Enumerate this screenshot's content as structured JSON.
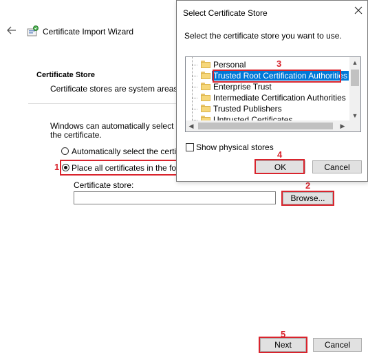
{
  "wizard": {
    "title": "Certificate Import Wizard",
    "section_title": "Certificate Store",
    "section_description": "Certificate stores are system areas wh",
    "intro_line1": "Windows can automatically select a ce",
    "intro_line2": "the certificate.",
    "radio_auto_label": "Automatically select the certifica",
    "radio_place_label": "Place all certificates in the follow",
    "store_field_label": "Certificate store:",
    "store_field_value": "",
    "browse_label": "Browse...",
    "next_label": "Next",
    "cancel_label": "Cancel"
  },
  "dialog": {
    "title": "Select Certificate Store",
    "instruction": "Select the certificate store you want to use.",
    "stores": [
      {
        "label": "Personal",
        "selected": false
      },
      {
        "label": "Trusted Root Certification Authorities",
        "selected": true
      },
      {
        "label": "Enterprise Trust",
        "selected": false
      },
      {
        "label": "Intermediate Certification Authorities",
        "selected": false
      },
      {
        "label": "Trusted Publishers",
        "selected": false
      },
      {
        "label": "Untrusted Certificates",
        "selected": false
      }
    ],
    "show_physical_label": "Show physical stores",
    "show_physical_checked": false,
    "ok_label": "OK",
    "cancel_label": "Cancel"
  },
  "annotations": [
    "1",
    "2",
    "3",
    "4",
    "5"
  ],
  "colors": {
    "annotation_red": "#d9242d",
    "selection_blue": "#0078d7",
    "button_face": "#e1e1e1"
  },
  "icons": {
    "back": "back-arrow-icon",
    "wizard": "certificate-wizard-icon",
    "close": "close-icon",
    "folder": "folder-icon"
  }
}
